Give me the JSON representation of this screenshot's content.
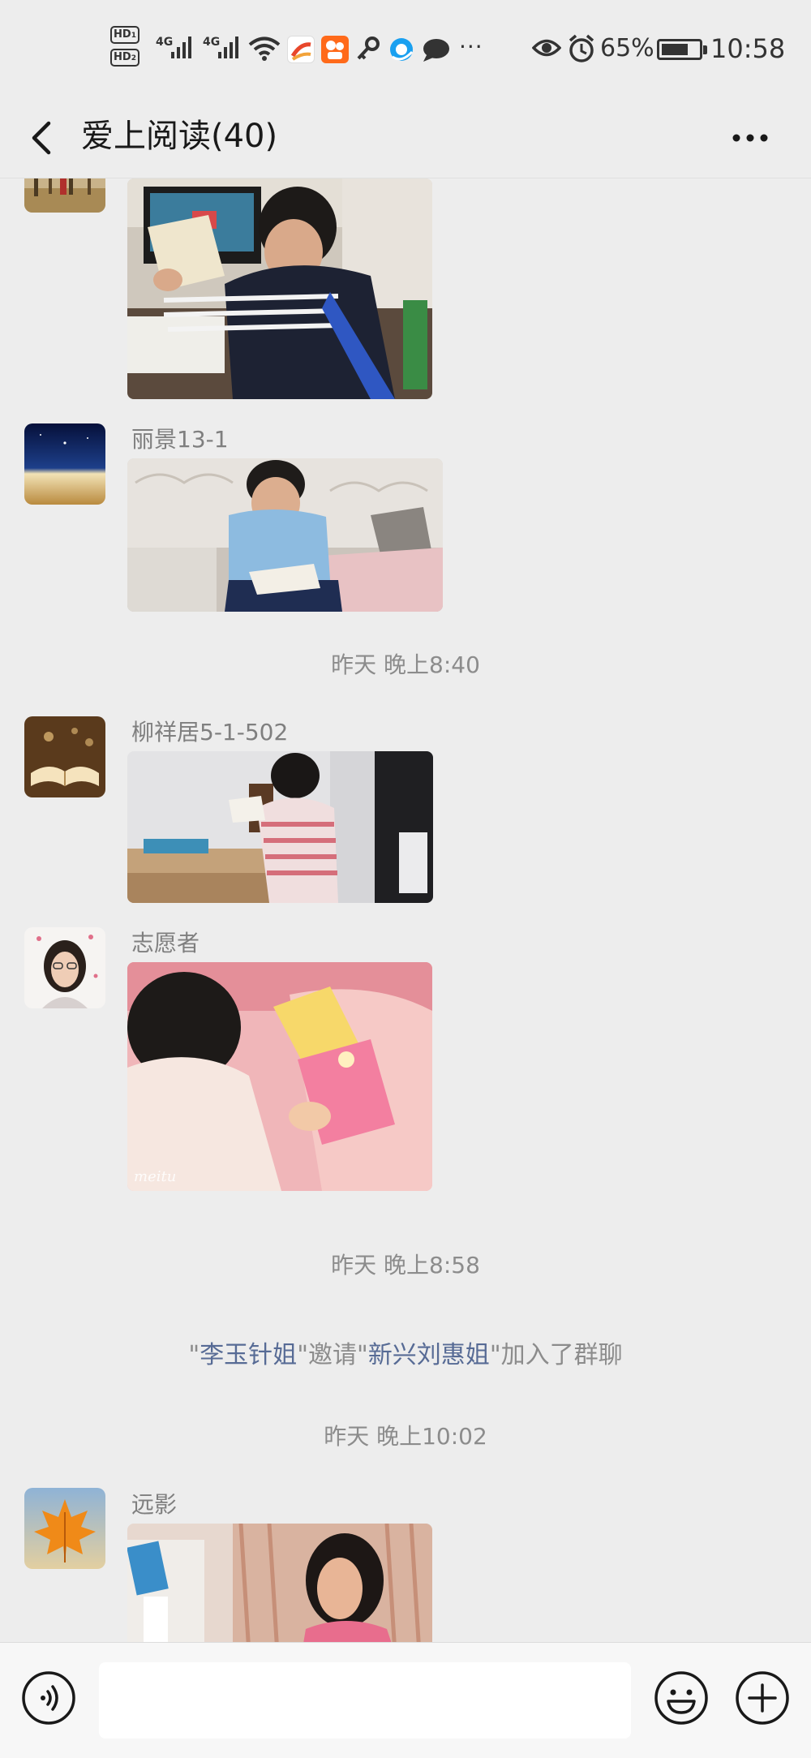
{
  "status_bar": {
    "hd1": "HD",
    "hd1_sub": "1",
    "hd2": "HD",
    "hd2_sub": "2",
    "net1": "4G",
    "net2": "4G",
    "more": "···",
    "battery_percent": "65%",
    "battery_level": 0.65,
    "time": "10:58",
    "icons": [
      "signal-icon",
      "signal-icon",
      "wifi-icon",
      "app-icon",
      "kuaishou-icon",
      "key-icon",
      "browser-icon",
      "message-icon",
      "eye-icon",
      "alarm-icon",
      "battery-icon"
    ]
  },
  "nav": {
    "title": "爱上阅读(40)",
    "back_icon": "chevron-left-icon",
    "more_icon": "more-icon"
  },
  "messages": [
    {
      "sender": "",
      "avatar": "forest-avatar",
      "photo": "boy-reading-at-computer-desk"
    },
    {
      "sender": "丽景13-1",
      "avatar": "night-sky-avatar",
      "photo": "boy-reading-on-sofa"
    },
    {
      "sender": "柳祥居5-1-502",
      "avatar": "open-book-avatar",
      "photo": "boy-reading-at-desk"
    },
    {
      "sender": "志愿者",
      "avatar": "woman-portrait-avatar",
      "photo": "child-reading-on-bed"
    },
    {
      "sender": "远影",
      "avatar": "maple-leaf-avatar",
      "photo": "girl-reading-in-room"
    }
  ],
  "timestamps": [
    "昨天 晚上8:40",
    "昨天 晚上8:58",
    "昨天 晚上10:02"
  ],
  "system": {
    "q1": "\"",
    "inviter": "李玉针姐",
    "q2": "\"",
    "invite_word": "邀请",
    "q3": "\"",
    "invitee": "新兴刘惠姐",
    "q4": "\"",
    "tail": "加入了群聊"
  },
  "photo_watermark": "meitu",
  "input": {
    "value": "",
    "voice_icon": "voice-icon",
    "emoji_icon": "emoji-icon",
    "plus_icon": "plus-icon"
  }
}
